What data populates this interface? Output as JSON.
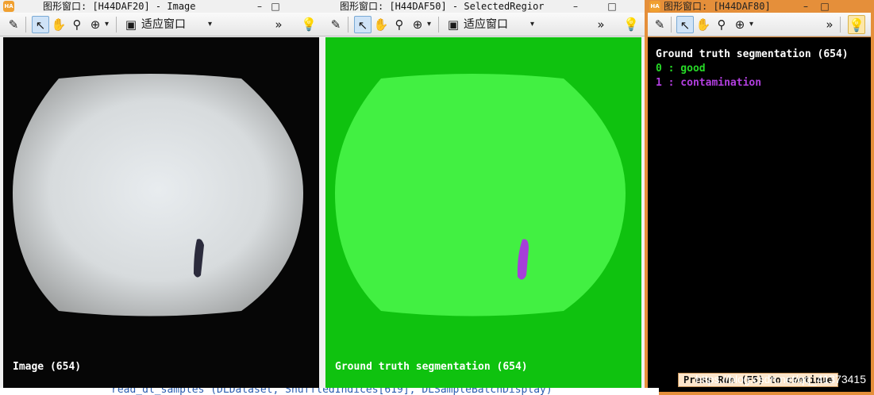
{
  "windows": [
    {
      "title": "图形窗口: [H44DAF20] - Image",
      "fit_label": "适应窗口",
      "caption": "Image (654)"
    },
    {
      "title": "图形窗口: [H44DAF50] - SelectedRegior",
      "fit_label": "适应窗口",
      "caption": "Ground truth segmentation (654)"
    },
    {
      "title": "图形窗口: [H44DAF80]",
      "legend": {
        "title": "Ground truth segmentation (654)",
        "items": [
          {
            "label": "0 : good",
            "color": "#27d927"
          },
          {
            "label": "1 : contamination",
            "color": "#b23fe0"
          }
        ]
      },
      "continue_label": "Press Run (F5) to continue"
    }
  ],
  "icons": {
    "app": "HA",
    "minimize": "–",
    "maximize": "□",
    "more": "»",
    "dropdown": "▾"
  },
  "code_line": "read_dl_samples (DLDataset, ShuffledIndices[619], DLSampleBatchDisplay)",
  "watermark": "https://blog.csdn.net/qq_41373415",
  "colors": {
    "overlay_green": "#3ff23f",
    "background_green": "#0fc20f",
    "defect_purple": "#a63fd9",
    "frame_orange": "#e58f3a"
  }
}
